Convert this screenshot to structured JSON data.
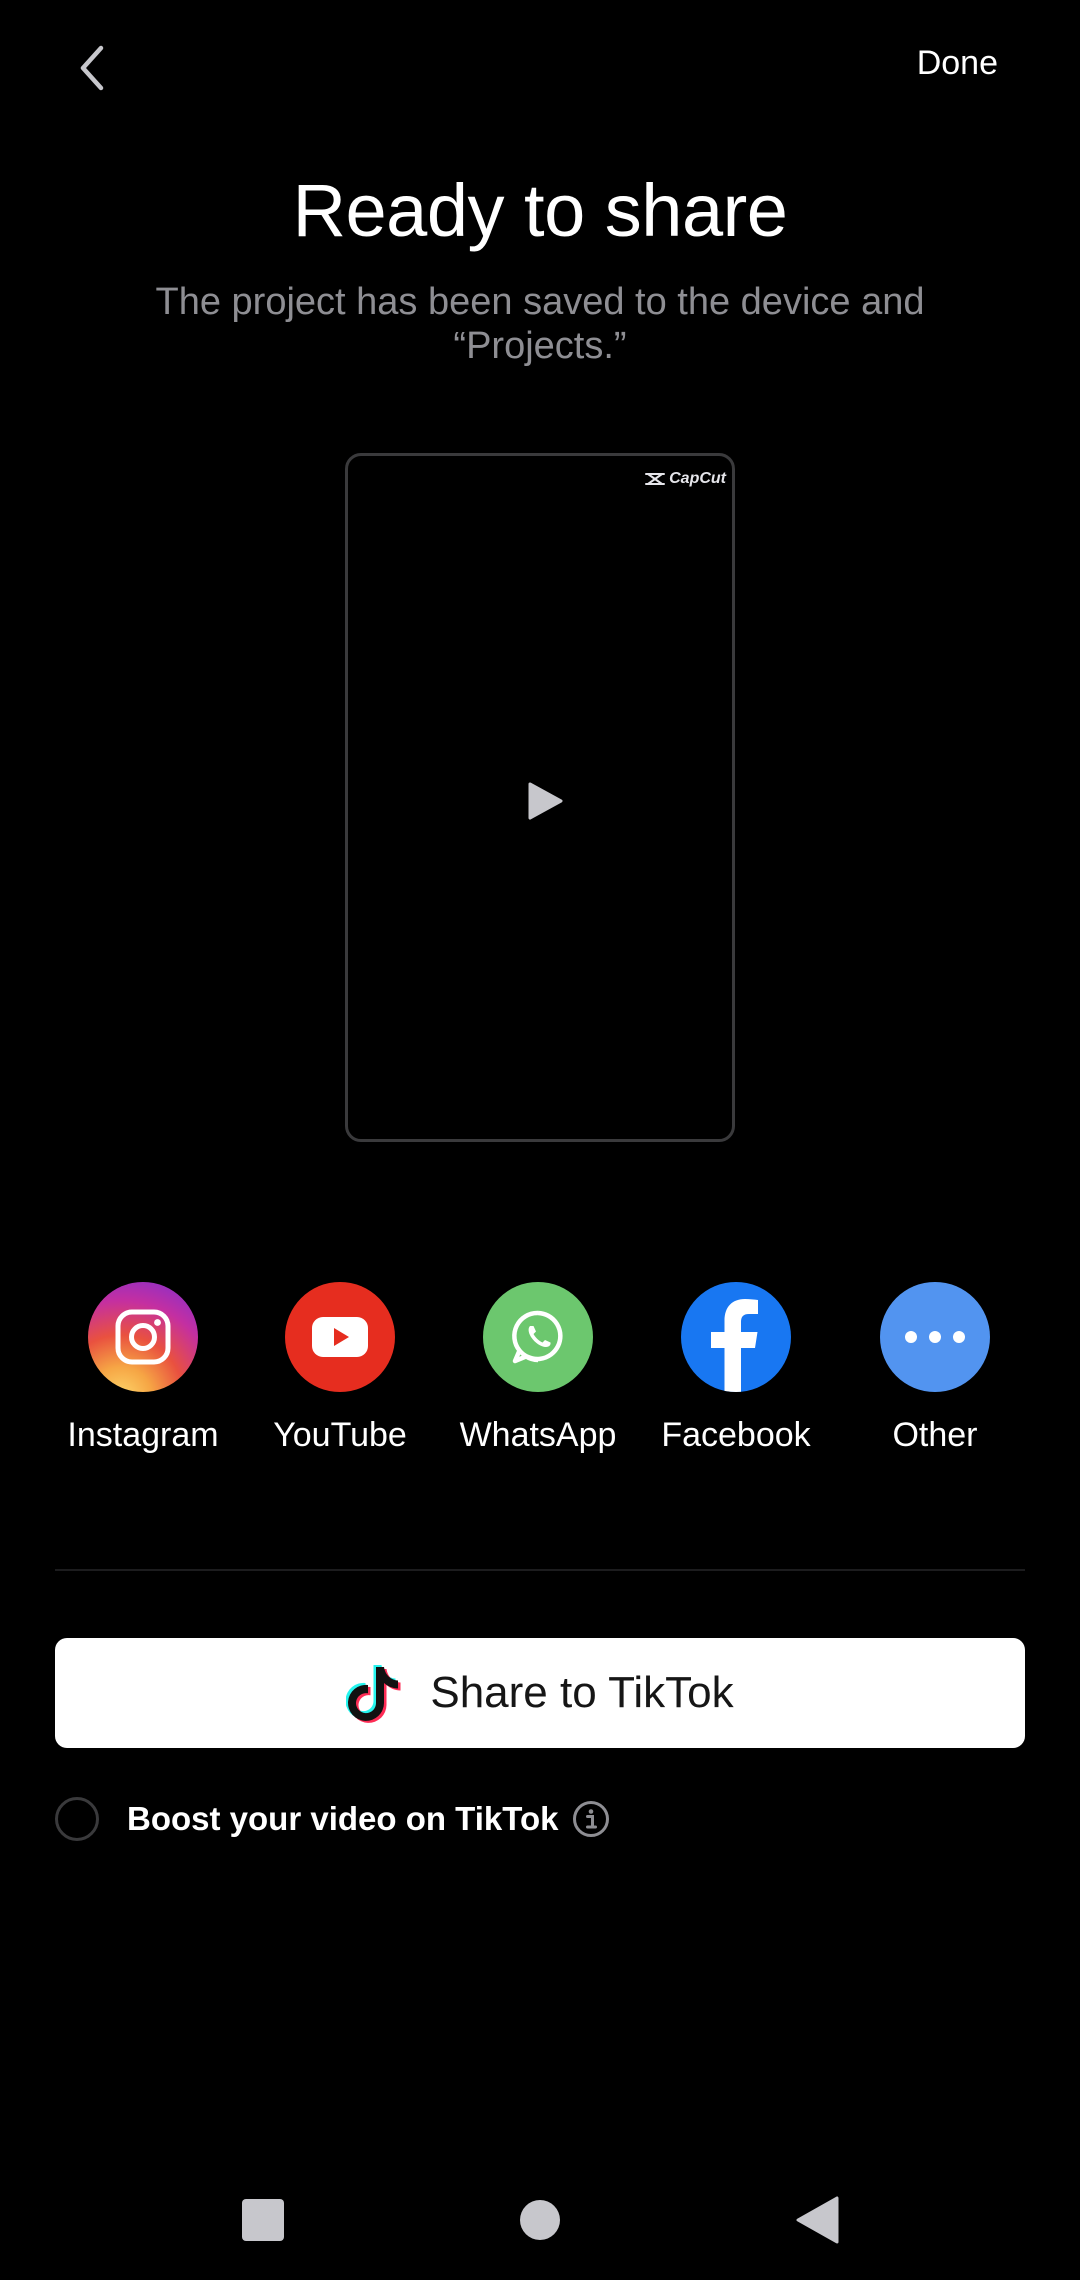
{
  "header": {
    "back_icon": "chevron-left-icon",
    "done_label": "Done"
  },
  "title": "Ready to share",
  "subtitle": "The project has been saved to the device and “Projects.”",
  "preview": {
    "watermark": "CapCut",
    "play_icon": "play-icon"
  },
  "share_targets": [
    {
      "label": "Instagram",
      "icon": "instagram-icon",
      "color": "#d6249f"
    },
    {
      "label": "YouTube",
      "icon": "youtube-icon",
      "color": "#e62d1f"
    },
    {
      "label": "WhatsApp",
      "icon": "whatsapp-icon",
      "color": "#6cc76e"
    },
    {
      "label": "Facebook",
      "icon": "facebook-icon",
      "color": "#1877f2"
    },
    {
      "label": "Other",
      "icon": "more-icon",
      "color": "#5294f0"
    }
  ],
  "tiktok_button": {
    "label": "Share to TikTok",
    "icon": "tiktok-icon"
  },
  "boost": {
    "label": "Boost your video on TikTok",
    "checked": false,
    "info_icon": "info-icon"
  },
  "navbar": {
    "recents_icon": "square-icon",
    "home_icon": "circle-icon",
    "back_icon": "triangle-back-icon"
  }
}
